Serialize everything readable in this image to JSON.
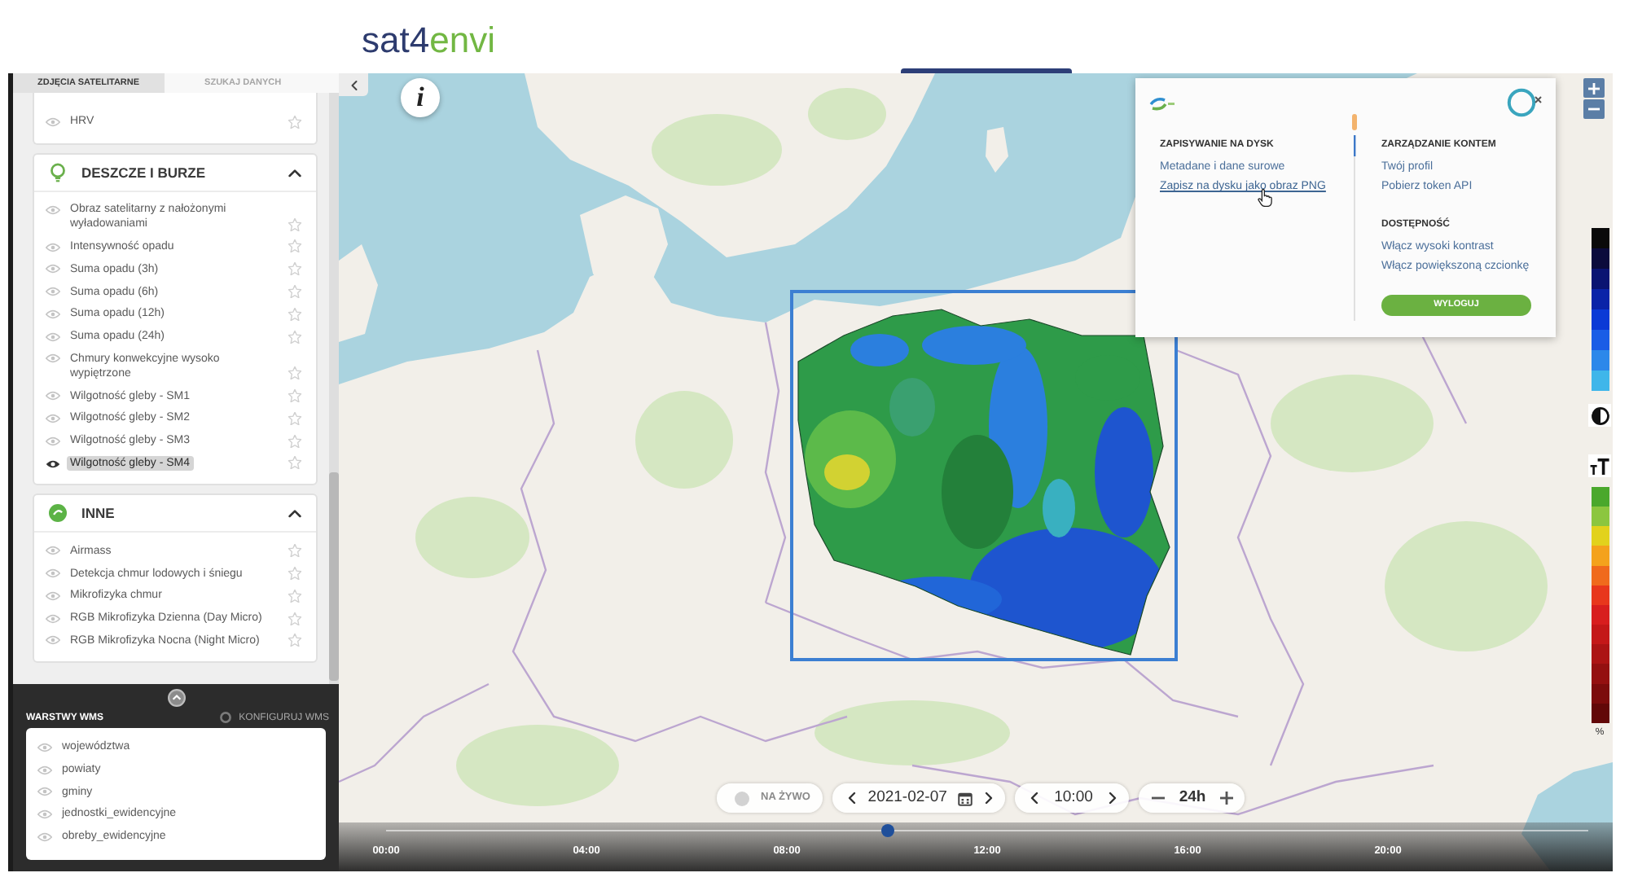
{
  "logo": {
    "primary": "sat4",
    "accent": "envi"
  },
  "sidebar": {
    "tabs": [
      {
        "label": "ZDJĘCIA SATELITARNE",
        "selected": true
      },
      {
        "label": "SZUKAJ DANYCH",
        "selected": false
      }
    ],
    "groups": [
      {
        "items": [
          {
            "label": "HRV",
            "selected": false,
            "favorite": false
          }
        ]
      },
      {
        "kind": "storm",
        "title": "DESZCZE I BURZE",
        "expanded": true,
        "items": [
          {
            "label": "Obraz satelitarny z nałożonymi wyładowaniami",
            "selected": false,
            "favorite": false
          },
          {
            "label": "Intensywność opadu",
            "selected": false,
            "favorite": false
          },
          {
            "label": "Suma opadu (3h)",
            "selected": false,
            "favorite": false
          },
          {
            "label": "Suma opadu (6h)",
            "selected": false,
            "favorite": false
          },
          {
            "label": "Suma opadu (12h)",
            "selected": false,
            "favorite": false
          },
          {
            "label": "Suma opadu (24h)",
            "selected": false,
            "favorite": false
          },
          {
            "label": "Chmury konwekcyjne wysoko wypiętrzone",
            "selected": false,
            "favorite": false
          },
          {
            "label": "Wilgotność gleby - SM1",
            "selected": false,
            "favorite": false
          },
          {
            "label": "Wilgotność gleby - SM2",
            "selected": false,
            "favorite": false
          },
          {
            "label": "Wilgotność gleby - SM3",
            "selected": false,
            "favorite": false
          },
          {
            "label": "Wilgotność gleby - SM4",
            "selected": true,
            "favorite": false
          }
        ]
      },
      {
        "kind": "misc",
        "title": "INNE",
        "expanded": true,
        "items": [
          {
            "label": "Airmass",
            "selected": false,
            "favorite": false
          },
          {
            "label": "Detekcja chmur lodowych i śniegu",
            "selected": false,
            "favorite": false
          },
          {
            "label": "Mikrofizyka chmur",
            "selected": false,
            "favorite": false
          },
          {
            "label": "RGB Mikrofizyka Dzienna (Day Micro)",
            "selected": false,
            "favorite": false
          },
          {
            "label": "RGB Mikrofizyka Nocna (Night Micro)",
            "selected": false,
            "favorite": false
          }
        ]
      }
    ],
    "wms": {
      "title": "WARSTWY WMS",
      "configure": "KONFIGURUJ WMS",
      "layers": [
        {
          "label": "województwa",
          "selected": false
        },
        {
          "label": "powiaty",
          "selected": false
        },
        {
          "label": "gminy",
          "selected": false
        },
        {
          "label": "jednostki_ewidencyjne",
          "selected": false
        },
        {
          "label": "obreby_ewidencyjne",
          "selected": false
        }
      ]
    }
  },
  "map": {
    "info_button": "i",
    "popup": {
      "columns": [
        {
          "sections": [
            {
              "heading": "ZAPISYWANIE NA DYSK",
              "links": [
                {
                  "label": "Metadane i dane surowe",
                  "hovered": false
                },
                {
                  "label": "Zapisz na dysku jako obraz PNG",
                  "hovered": true
                }
              ]
            }
          ]
        },
        {
          "sections": [
            {
              "heading": "ZARZĄDZANIE KONTEM",
              "links": [
                {
                  "label": "Twój profil",
                  "hovered": false
                },
                {
                  "label": "Pobierz token API",
                  "hovered": false
                }
              ]
            },
            {
              "heading": "DOSTĘPNOŚĆ",
              "links": [
                {
                  "label": "Włącz wysoki kontrast",
                  "hovered": false
                },
                {
                  "label": "Włącz powiększoną czcionkę",
                  "hovered": false
                }
              ]
            }
          ],
          "button": "WYLOGUJ"
        }
      ]
    },
    "legend": {
      "unit": "%"
    }
  },
  "timeline": {
    "live": false,
    "live_label": "NA ŻYWO",
    "date": "2021-02-07",
    "time": "10:00",
    "range": "24h",
    "ticks": [
      "00:00",
      "04:00",
      "08:00",
      "12:00",
      "16:00",
      "20:00"
    ],
    "level": 0.417
  }
}
